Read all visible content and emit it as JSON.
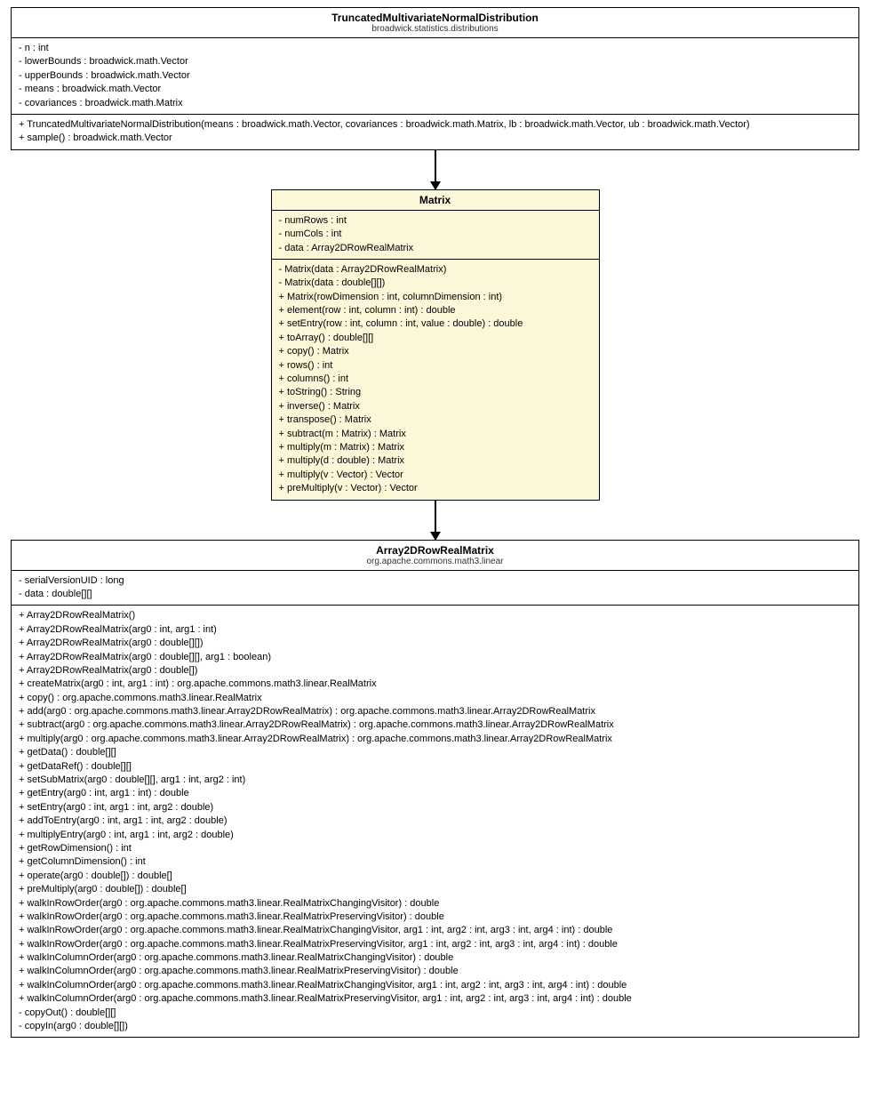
{
  "class1": {
    "name": "TruncatedMultivariateNormalDistribution",
    "pkg": "broadwick.statistics.distributions",
    "attrs": [
      "- n : int",
      "- lowerBounds : broadwick.math.Vector",
      "- upperBounds : broadwick.math.Vector",
      "- means : broadwick.math.Vector",
      "- covariances : broadwick.math.Matrix"
    ],
    "ops": [
      "+ TruncatedMultivariateNormalDistribution(means : broadwick.math.Vector, covariances : broadwick.math.Matrix, lb : broadwick.math.Vector, ub : broadwick.math.Vector)",
      "+ sample() : broadwick.math.Vector"
    ]
  },
  "class2": {
    "name": "Matrix",
    "attrs": [
      "- numRows : int",
      "- numCols : int",
      "- data : Array2DRowRealMatrix"
    ],
    "ops": [
      "- Matrix(data : Array2DRowRealMatrix)",
      "- Matrix(data : double[][])",
      "+ Matrix(rowDimension : int, columnDimension : int)",
      "+ element(row : int, column : int) : double",
      "+ setEntry(row : int, column : int, value : double) : double",
      "+ toArray() : double[][]",
      "+ copy() : Matrix",
      "+ rows() : int",
      "+ columns() : int",
      "+ toString() : String",
      "+ inverse() : Matrix",
      "+ transpose() : Matrix",
      "+ subtract(m : Matrix) : Matrix",
      "+ multiply(m : Matrix) : Matrix",
      "+ multiply(d : double) : Matrix",
      "+ multiply(v : Vector) : Vector",
      "+ preMultiply(v : Vector) : Vector"
    ]
  },
  "class3": {
    "name": "Array2DRowRealMatrix",
    "pkg": "org.apache.commons.math3.linear",
    "attrs": [
      "- serialVersionUID : long",
      "- data : double[][]"
    ],
    "ops": [
      "+ Array2DRowRealMatrix()",
      "+ Array2DRowRealMatrix(arg0 : int, arg1 : int)",
      "+ Array2DRowRealMatrix(arg0 : double[][])",
      "+ Array2DRowRealMatrix(arg0 : double[][], arg1 : boolean)",
      "+ Array2DRowRealMatrix(arg0 : double[])",
      "+ createMatrix(arg0 : int, arg1 : int) : org.apache.commons.math3.linear.RealMatrix",
      "+ copy() : org.apache.commons.math3.linear.RealMatrix",
      "+ add(arg0 : org.apache.commons.math3.linear.Array2DRowRealMatrix) : org.apache.commons.math3.linear.Array2DRowRealMatrix",
      "+ subtract(arg0 : org.apache.commons.math3.linear.Array2DRowRealMatrix) : org.apache.commons.math3.linear.Array2DRowRealMatrix",
      "+ multiply(arg0 : org.apache.commons.math3.linear.Array2DRowRealMatrix) : org.apache.commons.math3.linear.Array2DRowRealMatrix",
      "+ getData() : double[][]",
      "+ getDataRef() : double[][]",
      "+ setSubMatrix(arg0 : double[][], arg1 : int, arg2 : int)",
      "+ getEntry(arg0 : int, arg1 : int) : double",
      "+ setEntry(arg0 : int, arg1 : int, arg2 : double)",
      "+ addToEntry(arg0 : int, arg1 : int, arg2 : double)",
      "+ multiplyEntry(arg0 : int, arg1 : int, arg2 : double)",
      "+ getRowDimension() : int",
      "+ getColumnDimension() : int",
      "+ operate(arg0 : double[]) : double[]",
      "+ preMultiply(arg0 : double[]) : double[]",
      "+ walkInRowOrder(arg0 : org.apache.commons.math3.linear.RealMatrixChangingVisitor) : double",
      "+ walkInRowOrder(arg0 : org.apache.commons.math3.linear.RealMatrixPreservingVisitor) : double",
      "+ walkInRowOrder(arg0 : org.apache.commons.math3.linear.RealMatrixChangingVisitor, arg1 : int, arg2 : int, arg3 : int, arg4 : int) : double",
      "+ walkInRowOrder(arg0 : org.apache.commons.math3.linear.RealMatrixPreservingVisitor, arg1 : int, arg2 : int, arg3 : int, arg4 : int) : double",
      "+ walkInColumnOrder(arg0 : org.apache.commons.math3.linear.RealMatrixChangingVisitor) : double",
      "+ walkInColumnOrder(arg0 : org.apache.commons.math3.linear.RealMatrixPreservingVisitor) : double",
      "+ walkInColumnOrder(arg0 : org.apache.commons.math3.linear.RealMatrixChangingVisitor, arg1 : int, arg2 : int, arg3 : int, arg4 : int) : double",
      "+ walkInColumnOrder(arg0 : org.apache.commons.math3.linear.RealMatrixPreservingVisitor, arg1 : int, arg2 : int, arg3 : int, arg4 : int) : double",
      "- copyOut() : double[][]",
      "- copyIn(arg0 : double[][])"
    ]
  }
}
